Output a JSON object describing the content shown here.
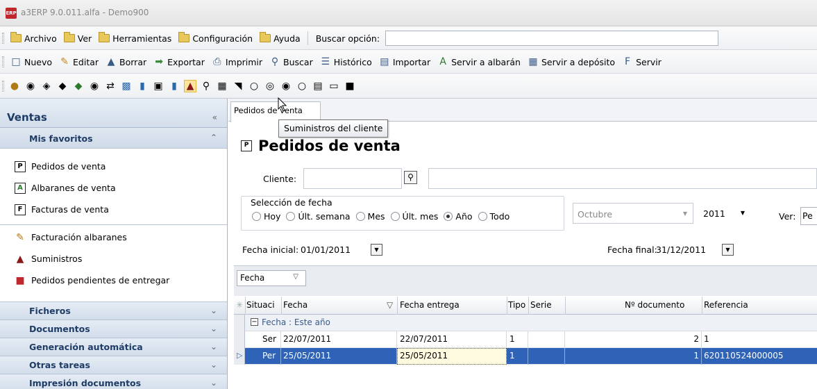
{
  "window": {
    "title": "a3ERP 9.0.011.alfa - Demo900",
    "icon_text": "ERP"
  },
  "menubar": {
    "items": [
      "Archivo",
      "Ver",
      "Herramientas",
      "Configuración",
      "Ayuda"
    ],
    "search_label": "Buscar opción:"
  },
  "toolbar": {
    "nuevo": "Nuevo",
    "editar": "Editar",
    "borrar": "Borrar",
    "exportar": "Exportar",
    "imprimir": "Imprimir",
    "buscar": "Buscar",
    "historico": "Histórico",
    "importar": "Importar",
    "servir_albaran": "Servir a albarán",
    "servir_deposito": "Servir a depósito",
    "servir": "Servir"
  },
  "tooltip": "Suministros del cliente",
  "sidebar": {
    "title": "Ventas",
    "favorites_title": "Mis favoritos",
    "favorites": [
      "Pedidos de venta",
      "Albaranes de venta",
      "Facturas de venta"
    ],
    "other": [
      "Facturación albaranes",
      "Suministros",
      "Pedidos pendientes de entregar"
    ],
    "sections": [
      "Ficheros",
      "Documentos",
      "Generación automática",
      "Otras tareas",
      "Impresión documentos"
    ]
  },
  "main": {
    "tab_label": "Pedidos de venta",
    "page_title": "Pedidos de venta",
    "cliente_label": "Cliente:",
    "fecha_group_label": "Selección de fecha",
    "radios": [
      {
        "label": "Hoy",
        "checked": false
      },
      {
        "label": "Últ. semana",
        "checked": false
      },
      {
        "label": "Mes",
        "checked": false
      },
      {
        "label": "Últ. mes",
        "checked": false
      },
      {
        "label": "Año",
        "checked": true
      },
      {
        "label": "Todo",
        "checked": false
      }
    ],
    "month": "Octubre",
    "year": "2011",
    "ver_label": "Ver:",
    "ver_value": "Pe",
    "fecha_inicial_label": "Fecha inicial:",
    "fecha_inicial": "01/01/2011",
    "fecha_final_label": "Fecha final:",
    "fecha_final": "31/12/2011",
    "group_chip": "Fecha"
  },
  "grid": {
    "columns": [
      "Situaci",
      "Fecha",
      "Fecha entrega",
      "Tipo",
      "Serie",
      "Nº documento",
      "Referencia"
    ],
    "group_label": "Fecha : Este año",
    "rows": [
      {
        "situacion": "Ser",
        "fecha": "22/07/2011",
        "entrega": "22/07/2011",
        "tipo": "1",
        "serie": "",
        "documento": "2",
        "referencia": "1",
        "selected": false
      },
      {
        "situacion": "Per",
        "fecha": "25/05/2011",
        "entrega": "25/05/2011",
        "tipo": "1",
        "serie": "",
        "documento": "1",
        "referencia": "620110524000005",
        "selected": true
      }
    ]
  }
}
